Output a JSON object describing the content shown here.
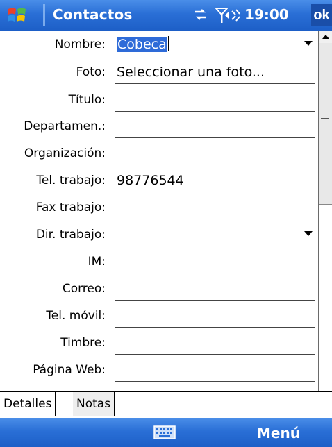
{
  "title_bar": {
    "app_title": "Contactos",
    "time": "19:00",
    "ok_label": "ok"
  },
  "form": {
    "fields": [
      {
        "label": "Nombre:",
        "value": "Cobeca",
        "dropdown": true,
        "selected": true
      },
      {
        "label": "Foto:",
        "value": "Seleccionar una foto...",
        "dropdown": false
      },
      {
        "label": "Título:",
        "value": "",
        "dropdown": false
      },
      {
        "label": "Departamen.:",
        "value": "",
        "dropdown": false
      },
      {
        "label": "Organización:",
        "value": "",
        "dropdown": false
      },
      {
        "label": "Tel. trabajo:",
        "value": "98776544",
        "dropdown": false
      },
      {
        "label": "Fax trabajo:",
        "value": "",
        "dropdown": false
      },
      {
        "label": "Dir. trabajo:",
        "value": "",
        "dropdown": true
      },
      {
        "label": "IM:",
        "value": "",
        "dropdown": false
      },
      {
        "label": "Correo:",
        "value": "",
        "dropdown": false
      },
      {
        "label": "Tel. móvil:",
        "value": "",
        "dropdown": false
      },
      {
        "label": "Timbre:",
        "value": "",
        "dropdown": false
      },
      {
        "label": "Página Web:",
        "value": "",
        "dropdown": false
      }
    ]
  },
  "tabs": [
    {
      "label": "Detalles",
      "active": true
    },
    {
      "label": "Notas",
      "active": false
    }
  ],
  "menu_bar": {
    "keyboard_icon": "keyboard-icon",
    "menu_label": "Menú"
  },
  "colors": {
    "bar_blue": "#2a6fd6",
    "selection": "#2e6bd8"
  }
}
